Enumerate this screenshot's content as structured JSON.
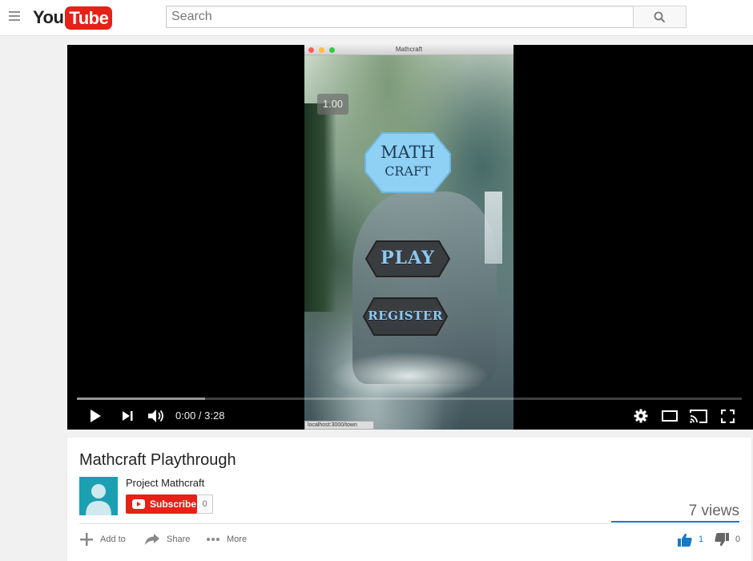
{
  "header": {
    "logo_you": "You",
    "logo_tube": "Tube",
    "search_placeholder": "Search"
  },
  "game": {
    "window_title": "Mathcraft",
    "score": "1.00",
    "logo_line1": "MATH",
    "logo_line2": "CRAFT",
    "play_label": "PLAY",
    "register_label": "REGISTER",
    "status_url": "localhost:3000/town"
  },
  "player": {
    "current_time": "0:00",
    "duration": "3:28",
    "time_display": "0:00 / 3:28",
    "buffered_fraction": 0.193
  },
  "video": {
    "title": "Mathcraft Playthrough",
    "channel": "Project Mathcraft",
    "subscribe_label": "Subscribe",
    "subscriber_count": "0",
    "views": "7 views",
    "add_to_label": "Add to",
    "share_label": "Share",
    "more_label": "More",
    "likes": "1",
    "dislikes": "0"
  },
  "colors": {
    "brand_red": "#e62117",
    "like_blue": "#167ac6",
    "math_badge": "#8fd0f5"
  }
}
